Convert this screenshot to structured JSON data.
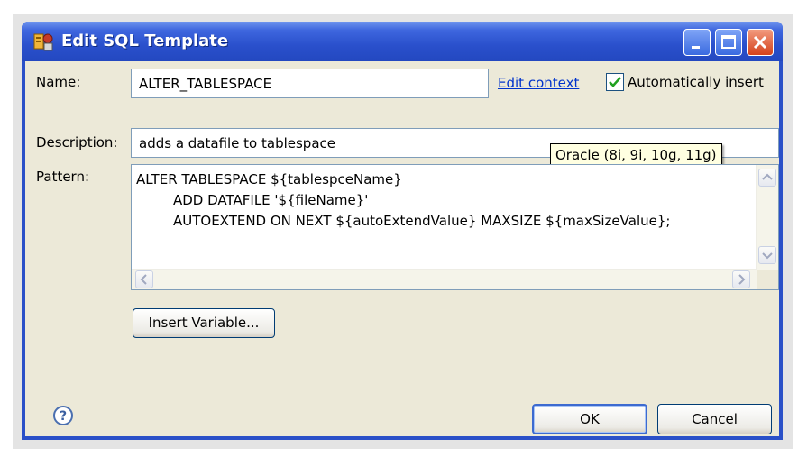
{
  "window": {
    "title": "Edit SQL Template"
  },
  "form": {
    "name_label": "Name:",
    "name_value": "ALTER_TABLESPACE",
    "edit_context_link": "Edit context",
    "auto_insert_label": "Automatically insert",
    "auto_insert_checked": true,
    "description_label": "Description:",
    "description_value": "adds a datafile to tablespace",
    "context_tooltip": "Oracle (8i, 9i, 10g, 11g)",
    "pattern_label": "Pattern:",
    "pattern_lines": [
      "ALTER TABLESPACE ${tablespceName}",
      "ADD DATAFILE '${fileName}'",
      "AUTOEXTEND ON NEXT ${autoExtendValue} MAXSIZE ${maxSizeValue};"
    ],
    "insert_variable_button": "Insert Variable..."
  },
  "footer": {
    "ok_label": "OK",
    "cancel_label": "Cancel"
  },
  "icons": {
    "app": "sql-template-icon",
    "help": "help-icon",
    "minimize": "minimize-icon",
    "maximize": "maximize-icon",
    "close": "close-icon"
  },
  "colors": {
    "titlebar": "#2a50c8",
    "dialog_bg": "#ece9d8",
    "link": "#0033cc",
    "tooltip_bg": "#ffffe1",
    "close_button": "#d4421c"
  }
}
